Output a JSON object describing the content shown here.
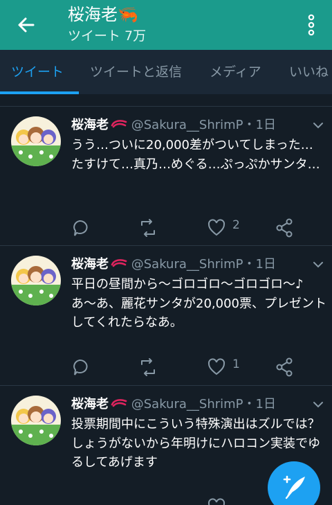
{
  "appbar": {
    "title": "桜海老🦐",
    "subtitle": "ツイート 7万",
    "bg_color": "#1b9b8c",
    "back_icon": "arrow-left-icon",
    "menu_icon": "more-vertical-icon"
  },
  "tabs": [
    {
      "label": "ツイート",
      "active": true
    },
    {
      "label": "ツイートと返信",
      "active": false
    },
    {
      "label": "メディア",
      "active": false
    },
    {
      "label": "いいね",
      "active": false
    }
  ],
  "tweets": [
    {
      "name": "桜海老",
      "handle": "@Sakura__ShrimP",
      "time": "・1日",
      "text": "うう…ついに20,000差がついてしまった…\nたすけて…真乃…めぐる…ぷっぷかサンタ…",
      "like_count": "2"
    },
    {
      "name": "桜海老",
      "handle": "@Sakura__ShrimP",
      "time": "・1日",
      "text": "平日の昼間から〜ゴロゴロ〜ゴロゴロ〜♪\nあ〜あ、麗花サンタが20,000票、プレゼントしてくれたらなあ。",
      "like_count": "1"
    },
    {
      "name": "桜海老",
      "handle": "@Sakura__ShrimP",
      "time": "・1日",
      "text": "投票期間中にこういう特殊演出はズルでは？\nしょうがないから年明けにハロコン実装でゆるしてあげます",
      "like_count": ""
    }
  ],
  "colors": {
    "background": "#141d26",
    "accent": "#1da1f2",
    "muted": "#8899a6"
  },
  "fab": {
    "icon": "compose-tweet-icon"
  }
}
